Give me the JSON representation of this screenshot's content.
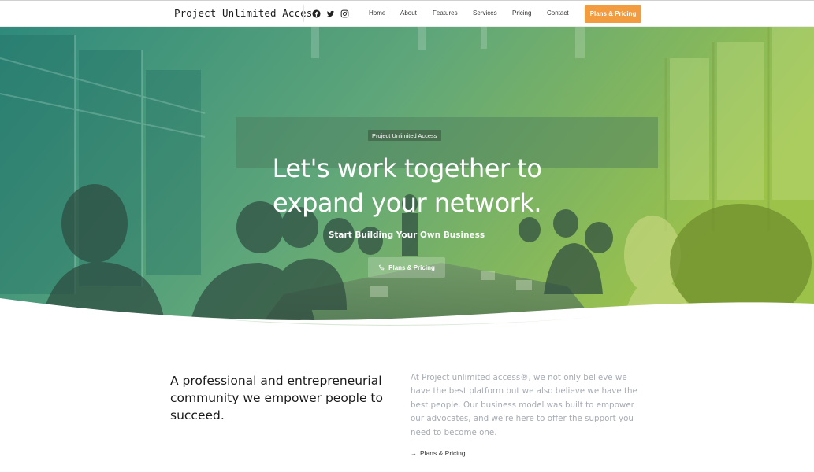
{
  "header": {
    "logo": "Project Unlimited Access",
    "social_icons": [
      "facebook-icon",
      "twitter-icon",
      "instagram-icon"
    ],
    "nav": [
      "Home",
      "About",
      "Features",
      "Services",
      "Pricing",
      "Contact"
    ],
    "cta_label": "Plans & Pricing"
  },
  "hero": {
    "tag": "Project Unlimited Access",
    "title_line1": "Let's work together to",
    "title_line2": "expand your network.",
    "subtitle": "Start Building Your Own Business",
    "button_label": "Plans & Pricing",
    "button_icon": "phone-icon"
  },
  "about": {
    "heading": "A professional and entrepreneurial community we empower people to succeed.",
    "body": "At Project unlimited access®, we not only believe we have the best platform but we also believe we have the best people. Our business model was built to empower our advocates, and we're here to offer the support you need to become one.",
    "link_label": "Plans & Pricing",
    "link_icon": "arrow-right-icon"
  },
  "colors": {
    "accent_orange": "#f39b3f",
    "hero_gradient_start": "#2f8a7c",
    "hero_gradient_end": "#9cc24a"
  }
}
